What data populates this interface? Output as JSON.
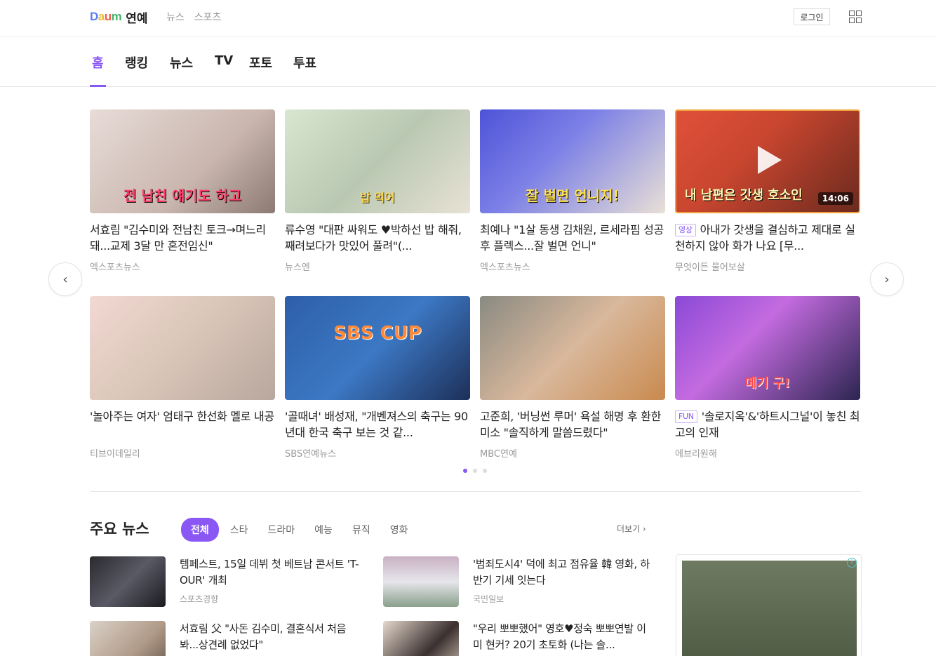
{
  "header": {
    "logo_text": "Daum",
    "section_title": "연예",
    "nav": [
      "뉴스",
      "스포츠"
    ],
    "login_label": "로그인"
  },
  "tabs": [
    "홈",
    "랭킹",
    "뉴스",
    "TV",
    "포토",
    "투표"
  ],
  "carousel": {
    "cards": [
      {
        "title": "서효림 \"김수미와 전남친 토크→며느리 돼...교제 3달 만 혼전임신\"",
        "source": "엑스포츠뉴스",
        "badge": "",
        "thumb_text": "전 남친 얘기도 하고"
      },
      {
        "title": "류수영 \"대판 싸워도 ♥박하선 밥 해줘, 째려보다가 맛있어 풀려\"(...",
        "source": "뉴스엔",
        "badge": "",
        "thumb_text": "밥 먹어"
      },
      {
        "title": "최예나 \"1살 동생 김채원, 르세라핌 성공 후 플렉스...잘 벌면 언니\"",
        "source": "엑스포츠뉴스",
        "badge": "",
        "thumb_text": "잘 벌면 언니지!"
      },
      {
        "title": "아내가 갓생을 결심하고 제대로 실천하지 않아 화가 나요 [무...",
        "source": "무엇이든 물어보살",
        "badge": "영상",
        "thumb_text": "내 남편은 갓생 호소인",
        "duration": "14:06"
      },
      {
        "title": "'놀아주는 여자' 엄태구 한선화 멜로 내공",
        "source": "티브이데일리",
        "badge": "",
        "thumb_text": ""
      },
      {
        "title": "'골때녀' 배성재, \"개벤져스의 축구는 90년대 한국 축구 보는 것 같...",
        "source": "SBS연예뉴스",
        "badge": "",
        "thumb_text": "SBS CUP"
      },
      {
        "title": "고준희, '버닝썬 루머' 욕설 해명 후 환한 미소 \"솔직하게 말씀드렸다\"",
        "source": "MBC연예",
        "badge": "",
        "thumb_text": ""
      },
      {
        "title": "'솔로지옥'&'하트시그널'이 놓친 최고의 인재",
        "source": "에브리원해",
        "badge": "FUN",
        "thumb_text": "메기 구!"
      }
    ]
  },
  "main_news": {
    "title": "주요 뉴스",
    "categories": [
      "전체",
      "스타",
      "드라마",
      "예능",
      "뮤직",
      "영화"
    ],
    "more_label": "더보기 ›",
    "items": [
      {
        "headline": "템페스트, 15일 데뷔 첫 베트남 콘서트 'T-OUR' 개최",
        "source": "스포츠경향"
      },
      {
        "headline": "'범죄도시4' 덕에 최고 점유율 韓 영화, 하반기 기세 잇는다",
        "source": "국민일보"
      },
      {
        "headline": "서효림 父 \"사돈 김수미, 결혼식서 처음 봐...상견례 없었다\"",
        "source": ""
      },
      {
        "headline": "\"우리 뽀뽀했어\" 영호♥정숙 뽀뽀연발 이미 현커? 20기 초토화 (나는 솔...",
        "source": ""
      }
    ]
  },
  "colors": {
    "accent": "#8a57f5"
  }
}
